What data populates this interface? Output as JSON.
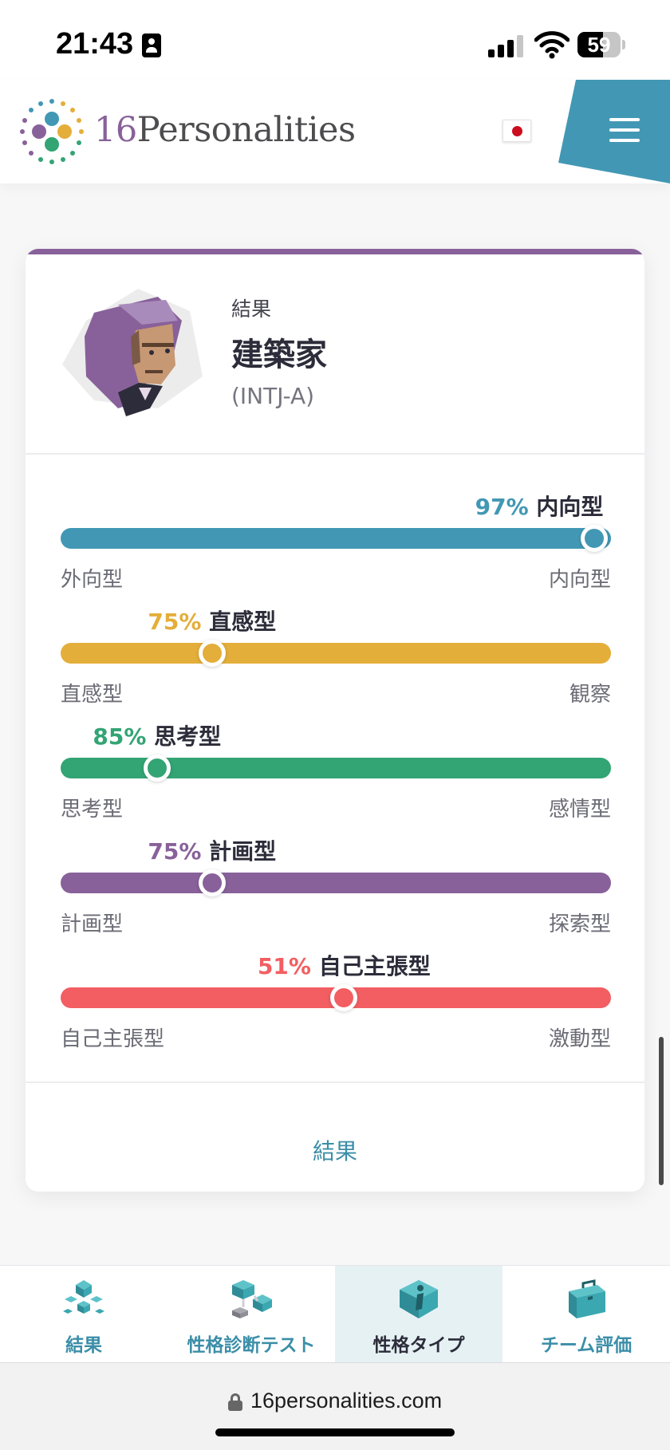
{
  "status": {
    "time": "21:43",
    "battery": "59",
    "battery_level": 0.59
  },
  "header": {
    "logo_num": "16",
    "logo_word": "Personalities",
    "flag": "jp-flag"
  },
  "result": {
    "label": "結果",
    "type_name": "建築家",
    "type_code": "(INTJ-A)"
  },
  "traits": [
    {
      "percent": "97%",
      "name": "内向型",
      "left": "外向型",
      "right": "内向型",
      "position": 0.97,
      "color": "#4298b4"
    },
    {
      "percent": "75%",
      "name": "直感型",
      "left": "直感型",
      "right": "観察",
      "position": 0.275,
      "color": "#e4ae3a"
    },
    {
      "percent": "85%",
      "name": "思考型",
      "left": "思考型",
      "right": "感情型",
      "position": 0.175,
      "color": "#33a474"
    },
    {
      "percent": "75%",
      "name": "計画型",
      "left": "計画型",
      "right": "探索型",
      "position": 0.275,
      "color": "#88619a"
    },
    {
      "percent": "51%",
      "name": "自己主張型",
      "left": "自己主張型",
      "right": "激動型",
      "position": 0.515,
      "color": "#f25e62"
    }
  ],
  "card_footer": "結果",
  "nav": [
    {
      "label": "結果",
      "icon": "results-icon"
    },
    {
      "label": "性格診断テスト",
      "icon": "test-icon"
    },
    {
      "label": "性格タイプ",
      "icon": "types-info-icon",
      "active": true
    },
    {
      "label": "チーム評価",
      "icon": "briefcase-icon"
    }
  ],
  "url": "16personalities.com"
}
